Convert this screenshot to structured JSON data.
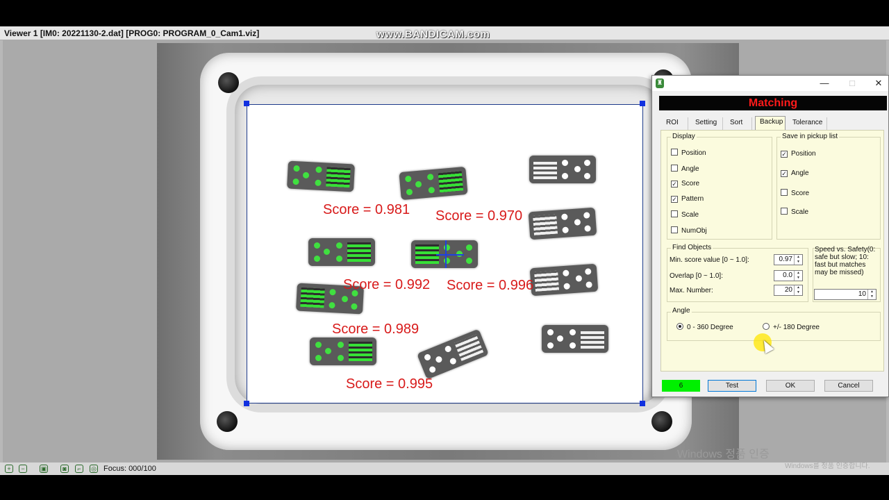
{
  "viewer": {
    "title": "Viewer 1 [IM0: 20221130-2.dat]  [PROG0: PROGRAM_0_Cam1.viz]",
    "watermark": "www.BANDICAM.com",
    "focus": "Focus: 000/100"
  },
  "results": {
    "scores": [
      "Score = 0.981",
      "Score = 0.970",
      "Score = 0.992",
      "Score = 0.996",
      "Score = 0.989",
      "Score = 0.995"
    ]
  },
  "os_overlay": {
    "activation_text": "Windows 정품 인증",
    "activation_sub": "Windows를 정품 인증합니다."
  },
  "dialog": {
    "header": "Matching",
    "tabs": [
      "ROI",
      "Setting",
      "Sort",
      "Backup",
      "Tolerance"
    ],
    "active_tab": "Backup",
    "display": {
      "label": "Display",
      "items": [
        {
          "label": "Position",
          "checked": false
        },
        {
          "label": "Angle",
          "checked": false
        },
        {
          "label": "Score",
          "checked": true
        },
        {
          "label": "Pattern",
          "checked": true
        },
        {
          "label": "Scale",
          "checked": false
        },
        {
          "label": "NumObj",
          "checked": false
        }
      ]
    },
    "pickup": {
      "label": "Save in pickup list",
      "items": [
        {
          "label": "Position",
          "checked": true
        },
        {
          "label": "Angle",
          "checked": true
        },
        {
          "label": "Score",
          "checked": false
        },
        {
          "label": "Scale",
          "checked": false
        }
      ]
    },
    "find_objects": {
      "label": "Find Objects",
      "min_score_label": "Min. score value [0 ~ 1.0]:",
      "min_score_value": "0.97",
      "overlap_label": "Overlap [0 ~ 1.0]:",
      "overlap_value": "0.0",
      "max_number_label": "Max. Number:",
      "max_number_value": "20"
    },
    "speed": {
      "text": "Speed vs. Safety(0: safe but slow; 10: fast but matches may be missed)",
      "value": "10"
    },
    "angle": {
      "label": "Angle",
      "option1": "0 - 360 Degree",
      "option2": "+/- 180 Degree",
      "selected": "0 - 360 Degree"
    },
    "found_count": "6",
    "test_label": "Test",
    "ok_label": "OK",
    "cancel_label": "Cancel"
  },
  "colors": {
    "score_text": "#d81a1a",
    "header_text": "#ff1a1a",
    "count_bg": "#00f000",
    "panel_bg": "#fbfbde",
    "pattern_overlay": "#37e037"
  }
}
